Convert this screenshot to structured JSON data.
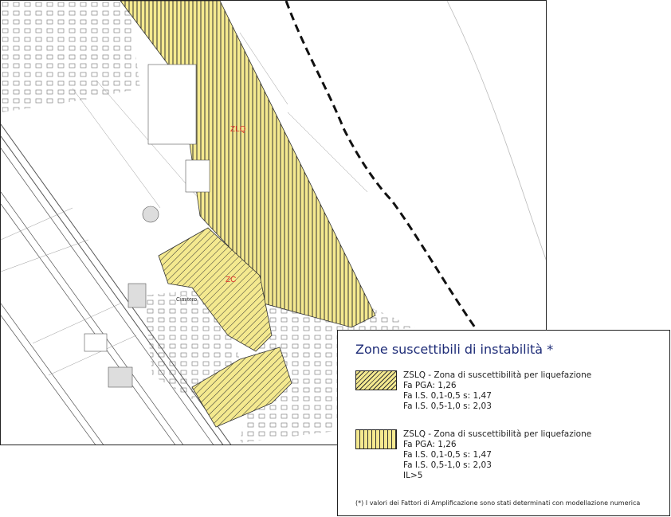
{
  "map": {
    "zone_markers": [
      "ZLQ",
      "ZC"
    ],
    "place_label": "Cimitero",
    "colors": {
      "zone_fill": "#f4e98f",
      "hatch": "#333333",
      "marker_text": "#e0332a",
      "coastline_dash": "#111111"
    }
  },
  "legend": {
    "title": "Zone suscettibili di instabilità *",
    "title_color": "#1f2d78",
    "entries": [
      {
        "pattern": "diagonal-hatch",
        "lines": [
          "ZSLQ - Zona di suscettibilità per liquefazione",
          "Fa PGA: 1,26",
          "Fa I.S. 0,1-0,5 s: 1,47",
          "Fa I.S. 0,5-1,0 s: 2,03"
        ]
      },
      {
        "pattern": "vertical-hatch",
        "lines": [
          "ZSLQ - Zona di suscettibilità per liquefazione",
          "Fa PGA: 1,26",
          "Fa I.S. 0,1-0,5 s: 1,47",
          "Fa I.S. 0,5-1,0 s: 2,03",
          "IL>5"
        ]
      }
    ],
    "footnote": "(*) I valori dei Fattori di Amplificazione sono stati determinati con modellazione numerica"
  }
}
